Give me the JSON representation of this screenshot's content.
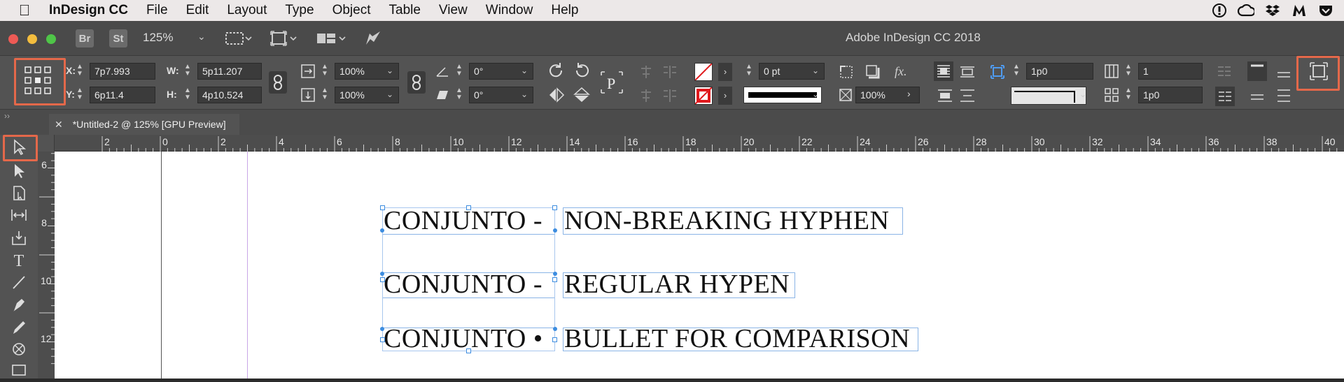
{
  "menubar": {
    "app_name": "InDesign CC",
    "items": [
      "File",
      "Edit",
      "Layout",
      "Type",
      "Object",
      "Table",
      "View",
      "Window",
      "Help"
    ]
  },
  "appbar": {
    "bridge_label": "Br",
    "stock_label": "St",
    "zoom": "125%",
    "title": "Adobe InDesign CC 2018"
  },
  "controls": {
    "x_label": "X:",
    "x_value": "7p7.993",
    "y_label": "Y:",
    "y_value": "6p11.4",
    "w_label": "W:",
    "w_value": "5p11.207",
    "h_label": "H:",
    "h_value": "4p10.524",
    "scale_x": "100%",
    "scale_y": "100%",
    "rotate": "0°",
    "shear": "0°",
    "stroke_weight": "0 pt",
    "opacity": "100%",
    "text_wrap_offset": "1p0",
    "columns": "1",
    "gutter": "1p0",
    "fx_label": "fx."
  },
  "tab": {
    "title": "*Untitled-2 @ 125% [GPU Preview]"
  },
  "ruler": {
    "h_ticks": [
      "2",
      "0",
      "2",
      "4",
      "6",
      "8",
      "10",
      "12",
      "14",
      "16",
      "18",
      "20",
      "22",
      "24",
      "26",
      "28",
      "30",
      "32",
      "34",
      "36",
      "38",
      "40"
    ],
    "v_ticks": [
      "6",
      "8",
      "10",
      "12"
    ]
  },
  "document": {
    "lines": [
      {
        "left": "CONJUNTO -",
        "right": "NON-BREAKING HYPHEN"
      },
      {
        "left": "CONJUNTO -",
        "right": "REGULAR HYPEN"
      },
      {
        "left": "CONJUNTO •",
        "right": "BULLET FOR COMPARISON"
      }
    ]
  },
  "colors": {
    "highlight": "#e4684a",
    "frame": "#8ab4e6",
    "guide_margin": "#c9a6e6"
  }
}
